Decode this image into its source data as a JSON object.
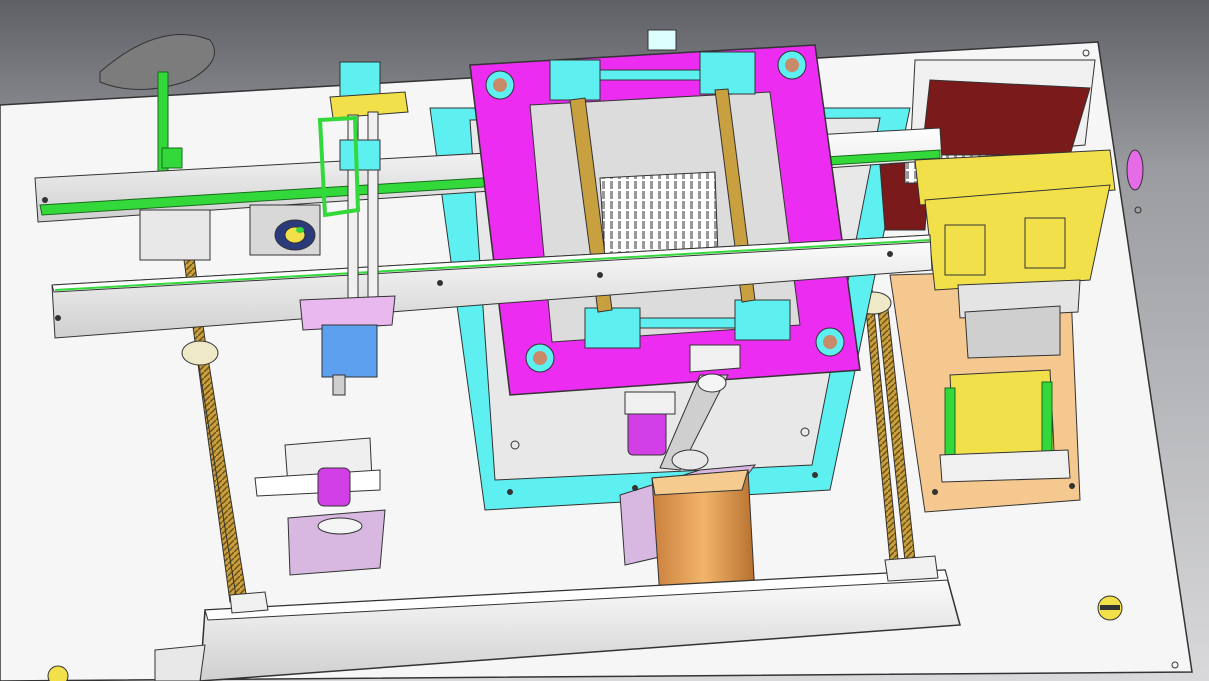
{
  "scene": {
    "subject": "cad-3d-model-printing-mechanism",
    "background": "#8a8c90",
    "colors": {
      "base_plate": "#f4f4f4",
      "magenta_frame": "#ec2cf0",
      "cyan_parts": "#5ef0f0",
      "yellow_parts": "#f2e04a",
      "orange_motor": "#e3a35a",
      "green_rods": "#33d83a",
      "peach_plate": "#f5c890",
      "dark_red_block": "#7a1a1a",
      "steel_grey": "#cfcfcf"
    }
  }
}
